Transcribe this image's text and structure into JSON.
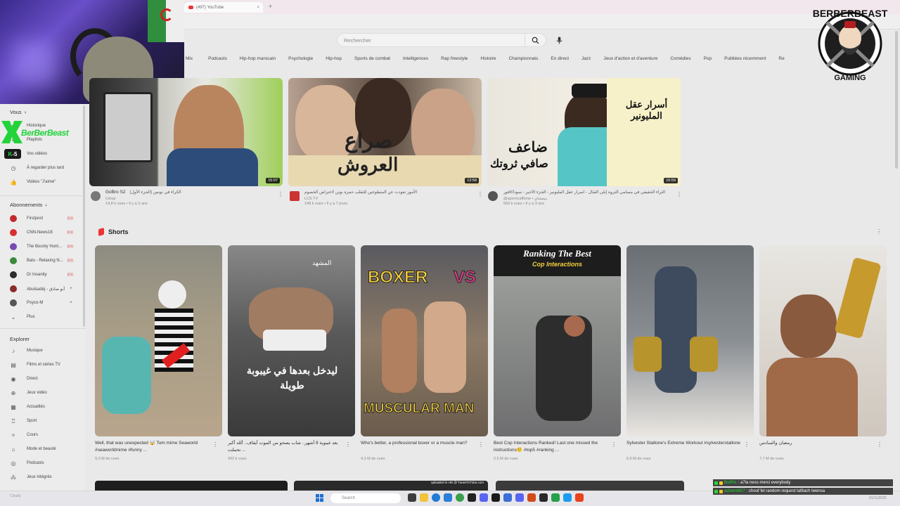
{
  "browser": {
    "tab_title": "(497) YouTube",
    "tab_close": "×",
    "new_tab": "+"
  },
  "sidebar": {
    "vous_label": "Vous",
    "vous_items": [
      {
        "label": "Historique",
        "icon": "history-icon"
      },
      {
        "label": "Playlists",
        "icon": "playlist-icon"
      },
      {
        "label": "Vos vidéos",
        "icon": "video-icon"
      },
      {
        "label": "À regarder plus tard",
        "icon": "clock-icon"
      },
      {
        "label": "Vidéos \"J'aime\"",
        "icon": "like-icon"
      }
    ],
    "abonnements_label": "Abonnements",
    "subscriptions": [
      {
        "label": "Firstpost",
        "color": "#c22a2a",
        "badge": "((•))"
      },
      {
        "label": "CNN-News18",
        "color": "#d63030",
        "badge": "((•))"
      },
      {
        "label": "The Bounty Hunt...",
        "color": "#7a4ab0",
        "badge": "((•))"
      },
      {
        "label": "Balu - Relaxing N...",
        "color": "#3a8a3a",
        "badge": "((•))"
      },
      {
        "label": "Dr Insanity",
        "color": "#2b2b2b",
        "badge": "((•))"
      },
      {
        "label": "Abulsadiq - أبو صادق",
        "color": "#8a2b2b",
        "badge": "•"
      },
      {
        "label": "Psyco-M",
        "color": "#555555",
        "badge": "•"
      }
    ],
    "plus_label": "Plus",
    "explorer_label": "Explorer",
    "explorer_items": [
      {
        "label": "Musique",
        "icon": "music-icon"
      },
      {
        "label": "Films et séries TV",
        "icon": "film-icon"
      },
      {
        "label": "Direct",
        "icon": "live-icon"
      },
      {
        "label": "Jeux vidéo",
        "icon": "gamepad-icon"
      },
      {
        "label": "Actualités",
        "icon": "news-icon"
      },
      {
        "label": "Sport",
        "icon": "trophy-icon"
      },
      {
        "label": "Cours",
        "icon": "bulb-icon"
      },
      {
        "label": "Mode et beauté",
        "icon": "hanger-icon"
      },
      {
        "label": "Podcasts",
        "icon": "podcast-icon"
      },
      {
        "label": "Jeux intégrés",
        "icon": "grid-icon"
      }
    ]
  },
  "overlay": {
    "channel_name": "BerBerBeast",
    "k5_left": "K",
    "k5_right": "5"
  },
  "search": {
    "placeholder": "Rechercher"
  },
  "chips": [
    "Mix",
    "Podcasts",
    "Hip-hop marocain",
    "Psychologie",
    "Hip-hop",
    "Sports de combat",
    "Intelligences",
    "Rap freestyle",
    "Histoire",
    "Championnats",
    "En direct",
    "Jazz",
    "Jeux d'action et d'aventure",
    "Comédies",
    "Pop",
    "Publiées récemment",
    "Re"
  ],
  "logo": {
    "top": "BERBERBEAST",
    "bottom": "GAMING"
  },
  "videos": [
    {
      "title_ar": "الكراء في تونس (الجزء الأول)",
      "channel": "GoBro S2",
      "sub1": "César",
      "sub2": "14,8 k vues • Il y a 3 ans",
      "duration": "15:07",
      "thumb_text": ""
    },
    {
      "title_ar": "الأمور تعودت عن المتطوعين للتقلب حمزة بوتن لاعتراض الخصوم",
      "channel": "",
      "sub1": "LCS TV",
      "sub2": "148 k vues • Il y a 7 jours",
      "duration": "13:58",
      "thumb_text_1": "صراع",
      "thumb_text_2": "العروش"
    },
    {
      "title_ar": "الثراء الحقيقي في مسامي الثروة إيلي القنال - اسرار عقل المليونير - الجزء الأخير - سوداكافور",
      "channel": "",
      "sub1": "@aperricaffeine • يبيعشاي",
      "sub2": "569 k vues • Il y a 3 ans",
      "duration": "16:59",
      "thumb_text_1": "ضاعف",
      "thumb_text_2": "صافي ثروتك",
      "thumb_text_3": "أسرار عقل المليونير"
    }
  ],
  "shorts_section": {
    "title": "Shorts",
    "items": [
      {
        "title": "Well, that was unexpected 🤯 Tom mime Seaworld #seaworldmime #funny ...",
        "views": "9,2 M de vues",
        "overlay": ""
      },
      {
        "title": "بعد غيبوبة 8 أشهر.. شاب يصحو من الموت أيقاف.. ألله أكبر تحملت ...",
        "views": "432 k vues",
        "overlay": "ليدخل بعدها في غيبوبة طويلة",
        "tag": "المشهد"
      },
      {
        "title": "Who's better, a professional boxer or a muscle man?",
        "views": "4,3 M de vues",
        "overlay_top": "BOXER",
        "overlay_vs": "VS",
        "overlay_bottom": "MUSCULAR MAN"
      },
      {
        "title": "Best Cop Interactions Ranked! Last one missed the instructions🤨 #top5 #ranking ...",
        "views": "2,5 M de vues",
        "overlay_top": "Ranking The Best",
        "overlay_sub": "Cop Interactions"
      },
      {
        "title": "Sylvester Stallone's Extreme Workout #sylvesterstallone",
        "views": "6,6 M de vues"
      },
      {
        "title": "رمضان والسادس",
        "views": "7,7 M de vues"
      }
    ]
  },
  "taskbar": {
    "left_text": "Cloudy",
    "search_placeholder": "Search",
    "right_text": "01/11/2025",
    "peek_text": "uploaded in HD @ TunesToTube.com"
  },
  "chat": [
    {
      "user": "BotRix",
      "message": ": a7la ness merci everybody"
    },
    {
      "user": "adzemt607",
      "message": ": chouf fel random request tal9ach twensa"
    }
  ]
}
